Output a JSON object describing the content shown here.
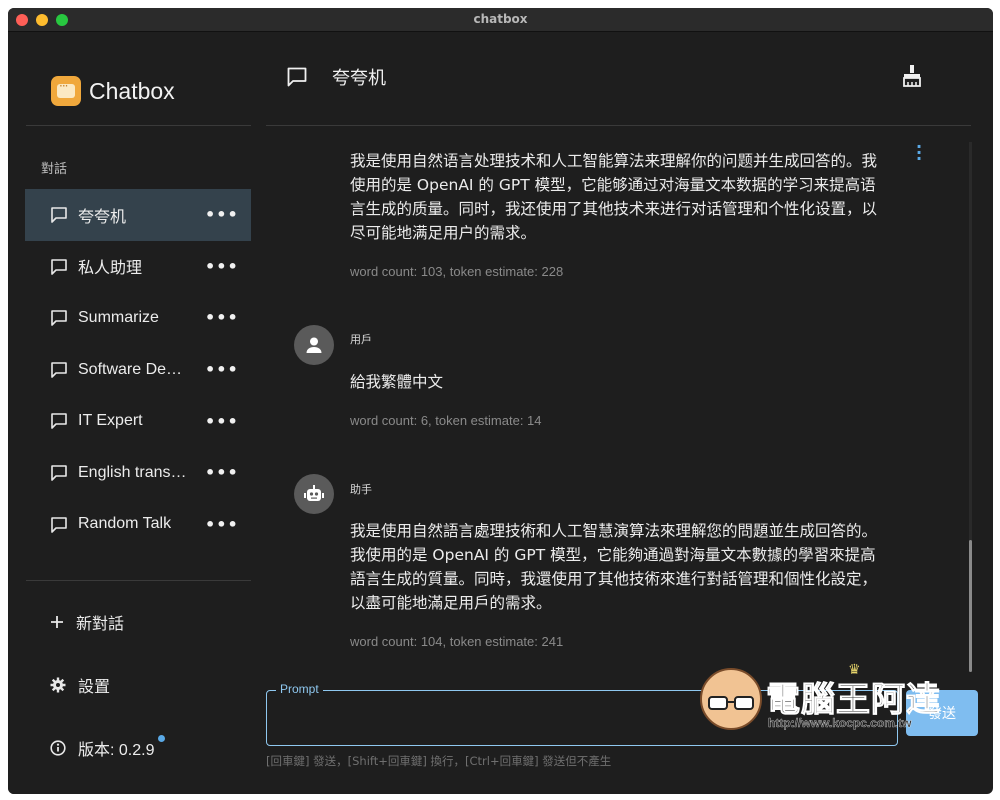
{
  "window": {
    "title": "chatbox"
  },
  "sidebar": {
    "brand": "Chatbox",
    "section_label": "對話",
    "conversations": [
      {
        "label": "夸夸机",
        "active": true
      },
      {
        "label": "私人助理",
        "active": false
      },
      {
        "label": "Summarize",
        "active": false
      },
      {
        "label": "Software Dev…",
        "active": false
      },
      {
        "label": "IT Expert",
        "active": false
      },
      {
        "label": "English transl…",
        "active": false
      },
      {
        "label": "Random Talk",
        "active": false
      }
    ],
    "more_label": "•••",
    "new_chat": "新對話",
    "settings": "設置",
    "version": "版本: 0.2.9"
  },
  "main": {
    "title": "夸夸机",
    "messages": [
      {
        "role": "",
        "text": "我是使用自然语言处理技术和人工智能算法来理解你的问题并生成回答的。我使用的是 OpenAI 的 GPT 模型，它能够通过对海量文本数据的学习来提高语言生成的质量。同时，我还使用了其他技术来进行对话管理和个性化设置，以尽可能地满足用户的需求。",
        "meta": "word count: 103, token estimate: 228"
      },
      {
        "role": "用戶",
        "text": "給我繁體中文",
        "meta": "word count: 6, token estimate: 14"
      },
      {
        "role": "助手",
        "text": "我是使用自然語言處理技術和人工智慧演算法來理解您的問題並生成回答的。我使用的是 OpenAI 的 GPT 模型，它能夠通過對海量文本數據的學習來提高語言生成的質量。同時，我還使用了其他技術來進行對話管理和個性化設定，以盡可能地滿足用戶的需求。",
        "meta": "word count: 104, token estimate: 241"
      }
    ],
    "prompt_legend": "Prompt",
    "send_label": "發送",
    "hint": "[回車鍵] 發送，[Shift+回車鍵] 換行，[Ctrl+回車鍵] 發送但不產生"
  },
  "watermark": {
    "title": "電腦王阿達",
    "url": "http://www.kocpc.com.tw"
  },
  "colors": {
    "accent": "#8fc8f0",
    "active_bg": "#34424c",
    "background": "#1e1e1e"
  }
}
